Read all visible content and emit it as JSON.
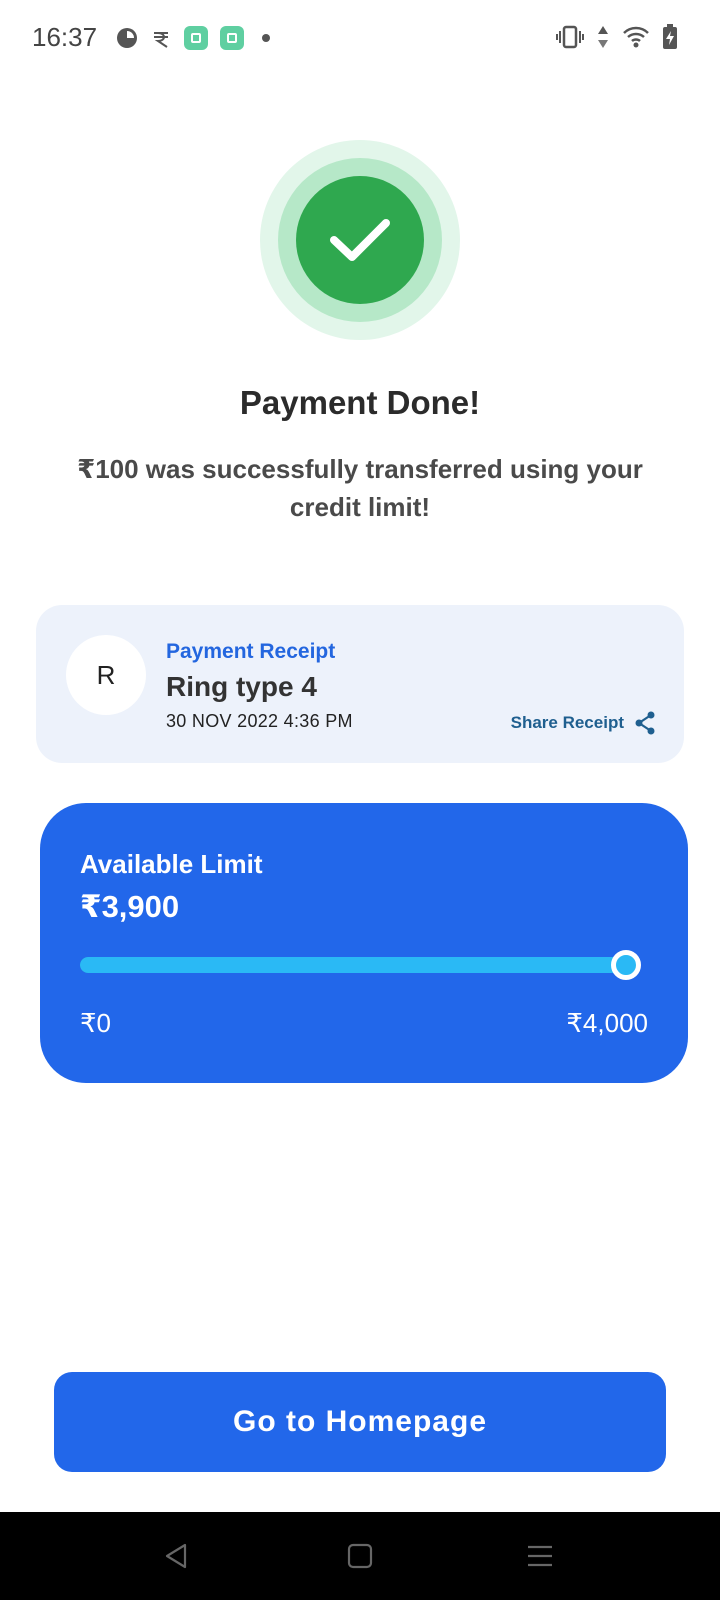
{
  "status_bar": {
    "time": "16:37",
    "left_icons": [
      "data-saver-icon",
      "rupee-app-icon",
      "app-notification-icon",
      "app-notification-icon",
      "more-notifications-dot-icon"
    ],
    "right_icons": [
      "vibrate-icon",
      "data-transfer-icon",
      "wifi-icon",
      "battery-charging-icon"
    ]
  },
  "success": {
    "icon": "check-icon",
    "title": "Payment Done!",
    "message": "₹100 was successfully transferred using your credit limit!",
    "colors": {
      "badge_core": "#2fa84f",
      "badge_ring": "#b6e8c8",
      "badge_outer": "#e2f6ea"
    }
  },
  "receipt": {
    "avatar_initial": "R",
    "label": "Payment Receipt",
    "name": "Ring type 4",
    "date": "30 NOV 2022 4:36 PM",
    "share_label": "Share Receipt",
    "share_icon": "share-icon"
  },
  "limit": {
    "label": "Available Limit",
    "value": "₹3,900",
    "min_label": "₹0",
    "max_label": "₹4,000",
    "available_fraction": 0.975
  },
  "cta": {
    "label": "Go to Homepage"
  },
  "nav": {
    "back_icon": "back-icon",
    "home_icon": "home-icon",
    "menu_icon": "recents-menu-icon"
  },
  "theme": {
    "primary": "#2267ea",
    "accent": "#2ab9f5",
    "link": "#2366df"
  }
}
